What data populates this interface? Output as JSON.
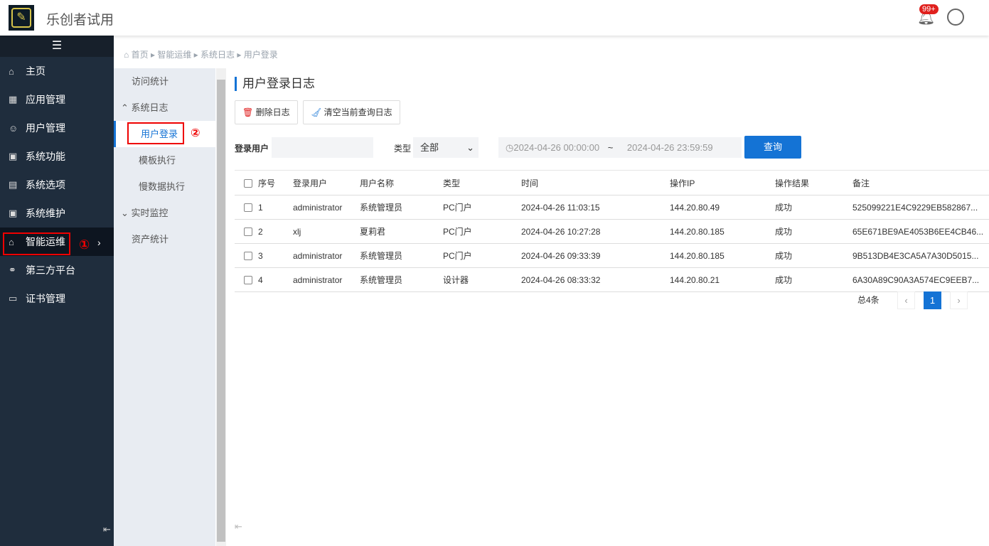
{
  "app": {
    "title": "乐创者试用",
    "notif_badge": "99+"
  },
  "sidebar": {
    "items": [
      {
        "label": "主页",
        "icon": "⌂"
      },
      {
        "label": "应用管理",
        "icon": "▦"
      },
      {
        "label": "用户管理",
        "icon": "☺"
      },
      {
        "label": "系统功能",
        "icon": "▣"
      },
      {
        "label": "系统选项",
        "icon": "▤"
      },
      {
        "label": "系统维护",
        "icon": "▣"
      },
      {
        "label": "智能运维",
        "icon": "⌂"
      },
      {
        "label": "第三方平台",
        "icon": "⚭"
      },
      {
        "label": "证书管理",
        "icon": "▭"
      }
    ],
    "step1": "①"
  },
  "submenu": {
    "items": [
      "访问统计",
      "系统日志",
      "用户登录",
      "模板执行",
      "慢数据执行",
      "实时监控",
      "资产统计"
    ],
    "step2": "②"
  },
  "breadcrumb": [
    "首页",
    "智能运维",
    "系统日志",
    "用户登录"
  ],
  "main": {
    "title": "用户登录日志",
    "delete_label": "删除日志",
    "clear_label": "清空当前查询日志",
    "user_label": "登录用户",
    "type_label": "类型",
    "type_value": "全部",
    "start": "2024-04-26 00:00:00",
    "sep": "~",
    "end": "2024-04-26 23:59:59",
    "query": "查询"
  },
  "table": {
    "headers": [
      "序号",
      "登录用户",
      "用户名称",
      "类型",
      "时间",
      "操作IP",
      "操作结果",
      "备注"
    ],
    "rows": [
      [
        "1",
        "administrator",
        "系统管理员",
        "PC门户",
        "2024-04-26 11:03:15",
        "144.20.80.49",
        "成功",
        "525099221E4C9229EB582867..."
      ],
      [
        "2",
        "xlj",
        "夏莉君",
        "PC门户",
        "2024-04-26 10:27:28",
        "144.20.80.185",
        "成功",
        "65E671BE9AE4053B6EE4CB46..."
      ],
      [
        "3",
        "administrator",
        "系统管理员",
        "PC门户",
        "2024-04-26 09:33:39",
        "144.20.80.185",
        "成功",
        "9B513DB4E3CA5A7A30D5015..."
      ],
      [
        "4",
        "administrator",
        "系统管理员",
        "设计器",
        "2024-04-26 08:33:32",
        "144.20.80.21",
        "成功",
        "6A30A89C90A3A574EC9EEB7..."
      ]
    ]
  },
  "pagination": {
    "total": "总4条",
    "page": "1"
  }
}
